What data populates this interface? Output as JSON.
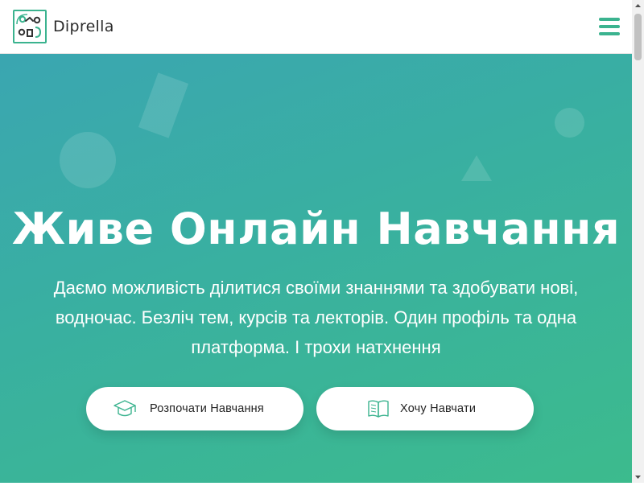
{
  "header": {
    "brand_name": "Diprella",
    "logo_icon": "diprella-logo-icon",
    "menu_icon": "hamburger-menu-icon"
  },
  "hero": {
    "headline": "Живе Онлайн Навчання",
    "subtitle": "Даємо можливість ділитися своїми знаннями та здобувати нові, водночас. Безліч тем, курсів та лекторів. Один профіль та одна платформа. І трохи натхнення",
    "buttons": [
      {
        "label": "Розпочати Навчання",
        "icon": "graduation-cap-icon"
      },
      {
        "label": "Хочу Навчати",
        "icon": "open-book-icon"
      }
    ]
  },
  "colors": {
    "accent": "#3bb38f",
    "hero_gradient_start": "#3aa6b1",
    "hero_gradient_end": "#3cbb8d",
    "button_bg": "#ffffff",
    "text_on_hero": "#ffffff"
  }
}
